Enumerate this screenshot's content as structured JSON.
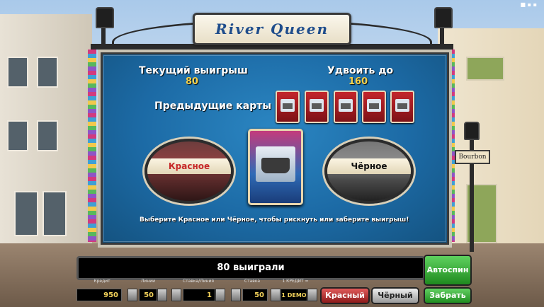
{
  "title": "River Queen",
  "gamble": {
    "current_win_label": "Текущий выигрыш",
    "current_win_value": "80",
    "double_to_label": "Удвоить до",
    "double_to_value": "160",
    "previous_cards_label": "Предыдущие карты",
    "red_label": "Красное",
    "black_label": "Чёрное",
    "instruction": "Выберите Красное или Чёрное, чтобы рискнуть или заберите выигрыш!"
  },
  "street_sign": "Bourbon",
  "status_message": "80 выиграли",
  "controls": {
    "credit_label": "Кредит",
    "credit_value": "950",
    "lines_label": "Линии",
    "lines_value": "50",
    "bet_per_line_label": "Ставка/Линия",
    "bet_per_line_value": "1",
    "bet_label": "Ставка",
    "bet_value": "50",
    "denom_label": "1 КРЕДИТ =",
    "denom_value": "1 DEMO"
  },
  "buttons": {
    "autospin": "Автоспин",
    "red": "Красный",
    "black": "Чёрный",
    "take": "Забрать"
  }
}
